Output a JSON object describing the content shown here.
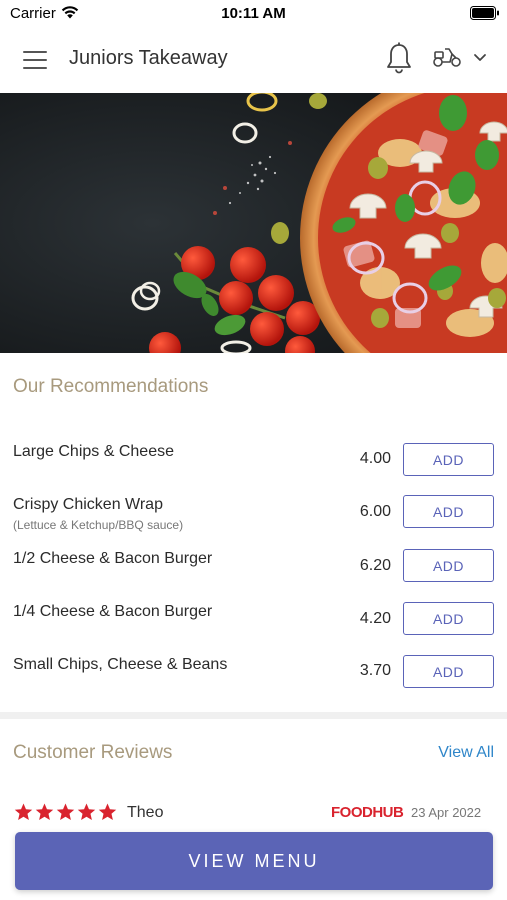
{
  "status_bar": {
    "carrier": "Carrier",
    "time": "10:11 AM"
  },
  "header": {
    "title": "Juniors Takeaway",
    "icons": [
      "menu-icon",
      "bell-icon",
      "scooter-icon",
      "chevron-down-icon"
    ]
  },
  "recommendations": {
    "title": "Our Recommendations",
    "items": [
      {
        "name": "Large Chips & Cheese",
        "description": "",
        "price": "4.00",
        "button": "ADD"
      },
      {
        "name": "Crispy Chicken Wrap",
        "description": "(Lettuce & Ketchup/BBQ sauce)",
        "price": "6.00",
        "button": "ADD"
      },
      {
        "name": "1/2 Cheese & Bacon Burger",
        "description": "",
        "price": "6.20",
        "button": "ADD"
      },
      {
        "name": "1/4 Cheese & Bacon Burger",
        "description": "",
        "price": "4.20",
        "button": "ADD"
      },
      {
        "name": "Small Chips, Cheese & Beans",
        "description": "",
        "price": "3.70",
        "button": "ADD"
      }
    ]
  },
  "reviews": {
    "title": "Customer Reviews",
    "view_all": "View All",
    "items": [
      {
        "rating": 5,
        "reviewer": "Theo",
        "source": "FOODHUB",
        "date": "23 Apr 2022"
      }
    ]
  },
  "view_menu_button": "VIEW MENU",
  "colors": {
    "accent": "#5b64b6",
    "section_title": "#a89a7e",
    "link": "#2f86c9",
    "star": "#d9232e",
    "brand": "#d9232e"
  }
}
